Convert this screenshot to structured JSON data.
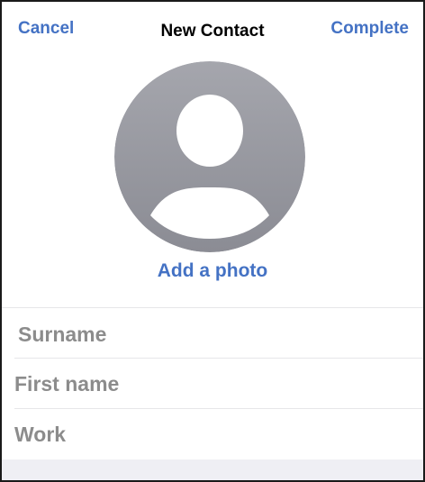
{
  "nav": {
    "cancel_label": "Cancel",
    "title": "New Contact",
    "complete_label": "Complete"
  },
  "avatar": {
    "icon": "person-silhouette-icon",
    "gradient_top": "#a5a6ad",
    "gradient_bottom": "#8b8c94",
    "silhouette_color": "#ffffff"
  },
  "photo": {
    "add_label": "Add a photo"
  },
  "form": {
    "surname_placeholder": "Surname",
    "first_name_placeholder": "First name",
    "work_placeholder": "Work"
  },
  "colors": {
    "accent": "#4472c4",
    "placeholder_text": "#8c8c8c",
    "separator": "#e6e6e9",
    "footer_background": "#efeff4"
  }
}
